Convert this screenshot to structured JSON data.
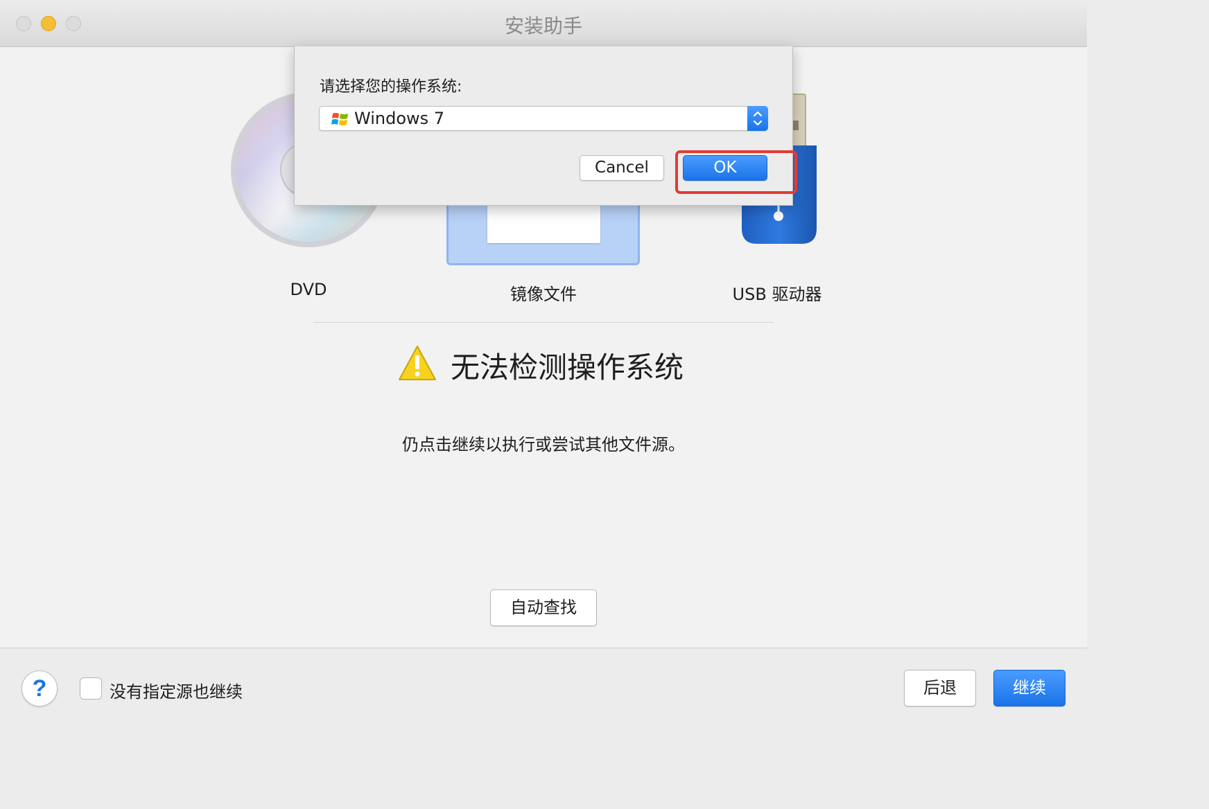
{
  "window": {
    "title": "安装助手"
  },
  "sources": [
    {
      "label": "DVD"
    },
    {
      "label": "镜像文件"
    },
    {
      "label": "USB 驱动器"
    }
  ],
  "warning": {
    "title": "无法检测操作系统",
    "message": "仍点击继续以执行或尝试其他文件源。"
  },
  "auto_detect_button": "自动查找",
  "bottom_bar": {
    "help_label": "?",
    "checkbox_label": "没有指定源也继续",
    "checkbox_checked": false,
    "back_button": "后退",
    "continue_button": "继续"
  },
  "os_dialog": {
    "prompt": "请选择您的操作系统:",
    "selected_os": "Windows 7",
    "os_icon": "windows-logo-icon",
    "cancel_button": "Cancel",
    "ok_button": "OK"
  },
  "colors": {
    "accent": "#1a73e8",
    "highlight_box": "#e23b35",
    "selected_tile": "#b8d1f7"
  }
}
